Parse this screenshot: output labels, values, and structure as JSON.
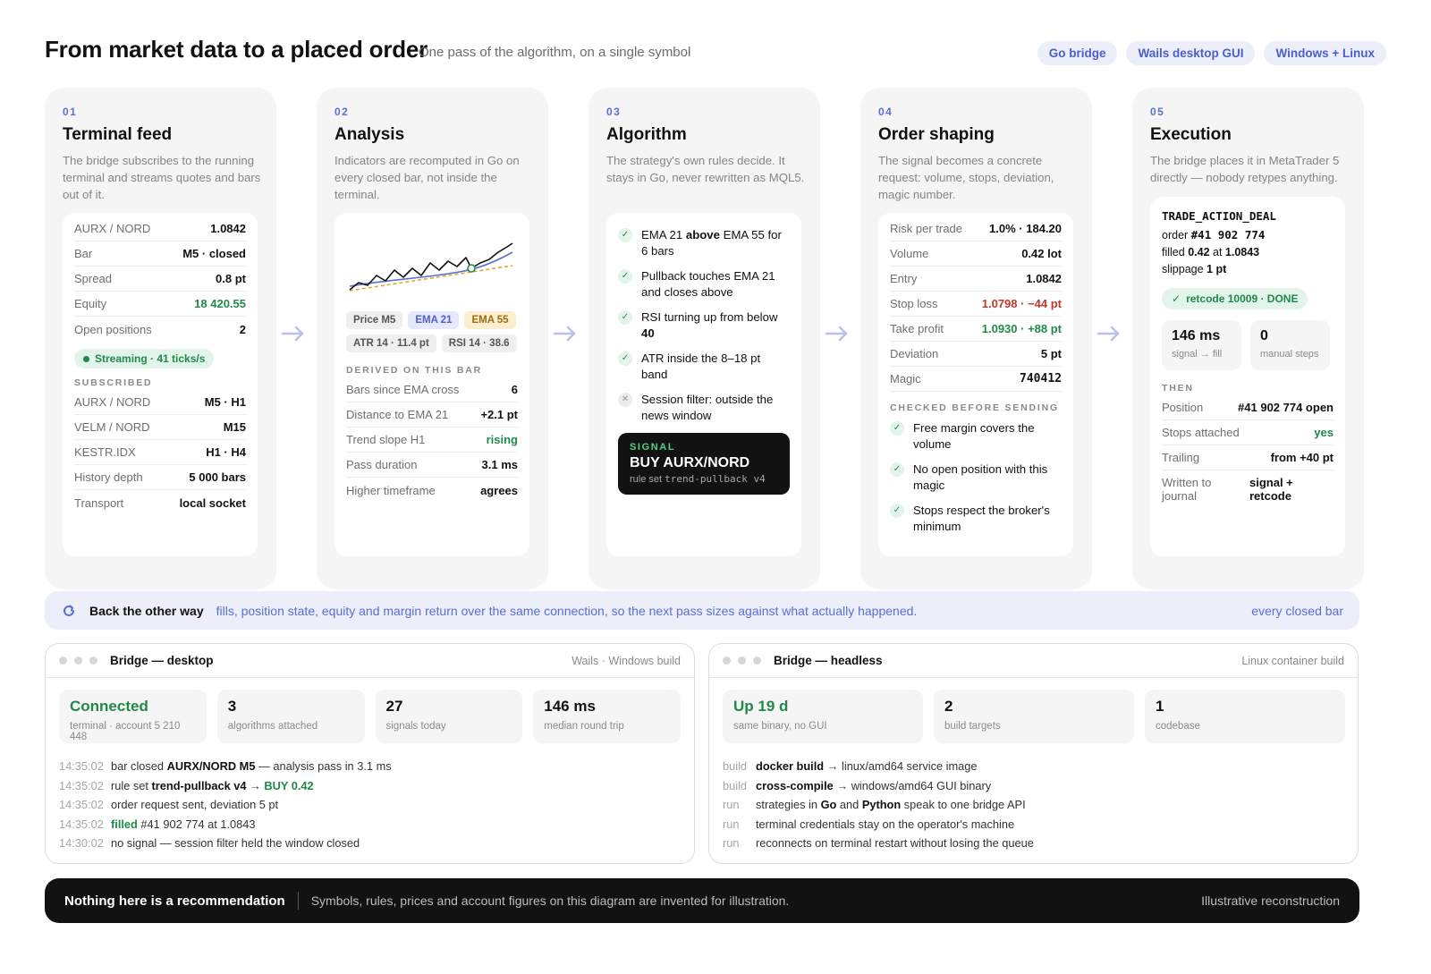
{
  "header": {
    "title": "From market data to a placed order",
    "subtitle": "One pass of the algorithm, on a single symbol",
    "tags": [
      "Go bridge",
      "Wails desktop GUI",
      "Windows + Linux"
    ]
  },
  "colors": {
    "accent": "#5a6fd0",
    "green": "#1f8a48",
    "red": "#c0392b",
    "dark": "#121212"
  },
  "stages": [
    {
      "num": "01",
      "title": "Terminal feed",
      "desc": "The bridge subscribes to the running terminal and streams quotes and bars out of it.",
      "rows": [
        {
          "k": "AURX / NORD",
          "v": "1.0842"
        },
        {
          "k": "Bar",
          "v": "M5 · closed"
        },
        {
          "k": "Spread",
          "v": "0.8 pt"
        },
        {
          "k": "Equity",
          "v": "18 420.55"
        },
        {
          "k": "Open positions",
          "v": "2"
        }
      ],
      "stream": "Streaming · 41 ticks/s",
      "section": "SUBSCRIBED",
      "subs": [
        {
          "k": "AURX / NORD",
          "v": "M5 · H1"
        },
        {
          "k": "VELM / NORD",
          "v": "M15"
        },
        {
          "k": "KESTR.IDX",
          "v": "H1 · H4"
        },
        {
          "k": "History depth",
          "v": "5 000 bars"
        },
        {
          "k": "Transport",
          "v": "local socket"
        }
      ]
    },
    {
      "num": "02",
      "title": "Analysis",
      "desc": "Indicators are recomputed in Go on every closed bar, not inside the terminal.",
      "indicators": [
        "Price M5",
        "EMA 21",
        "EMA 55",
        "ATR 14 · 11.4 pt",
        "RSI 14 · 38.6"
      ],
      "section": "DERIVED ON THIS BAR",
      "rows": [
        {
          "k": "Bars since EMA cross",
          "v": "6"
        },
        {
          "k": "Distance to EMA 21",
          "v": "+2.1 pt"
        },
        {
          "k": "Trend slope H1",
          "v": "rising"
        },
        {
          "k": "Pass duration",
          "v": "3.1 ms"
        },
        {
          "k": "Higher timeframe",
          "v": "agrees"
        }
      ]
    },
    {
      "num": "03",
      "title": "Algorithm",
      "desc": "The strategy's own rules decide. It stays in Go, never rewritten as MQL5.",
      "rules": [
        {
          "a": "EMA 21 ",
          "b": "above",
          "c": " EMA 55 for 6 bars"
        },
        {
          "a": "Pullback touches EMA 21 and closes above",
          "b": "",
          "c": ""
        },
        {
          "a": "RSI turning up from below ",
          "b": "40",
          "c": ""
        },
        {
          "a": "ATR inside the 8–18 pt band",
          "b": "",
          "c": ""
        },
        {
          "a": "Session filter: outside the news window",
          "b": "",
          "c": ""
        }
      ],
      "signal": {
        "label": "SIGNAL",
        "value": "BUY AURX/NORD",
        "ruleset_prefix": "rule set ",
        "ruleset": "trend-pullback v4"
      }
    },
    {
      "num": "04",
      "title": "Order shaping",
      "desc": "The signal becomes a concrete request: volume, stops, deviation, magic number.",
      "rows": [
        {
          "k": "Risk per trade",
          "v": "1.0% · 184.20"
        },
        {
          "k": "Volume",
          "v": "0.42 lot"
        },
        {
          "k": "Entry",
          "v": "1.0842"
        },
        {
          "k": "Stop loss",
          "v": "1.0798 · −44 pt"
        },
        {
          "k": "Take profit",
          "v": "1.0930 · +88 pt"
        },
        {
          "k": "Deviation",
          "v": "5 pt"
        },
        {
          "k": "Magic",
          "v": "740412"
        }
      ],
      "section": "CHECKED BEFORE SENDING",
      "checks": [
        "Free margin covers the volume",
        "No open position with this magic",
        "Stops respect the broker's minimum"
      ]
    },
    {
      "num": "05",
      "title": "Execution",
      "desc": "The bridge places it in MetaTrader 5 directly — nobody retypes anything.",
      "deal": {
        "action": "TRADE_ACTION_DEAL",
        "order_label": "order ",
        "order": "#41 902 774",
        "filled_label": "filled ",
        "filled": "0.42",
        "at_label": " at ",
        "at": "1.0843",
        "slippage_label": "slippage ",
        "slippage": "1 pt"
      },
      "retcode": "retcode 10009 · DONE",
      "minis": [
        {
          "v": "146 ms",
          "l": "signal → fill"
        },
        {
          "v": "0",
          "l": "manual steps"
        }
      ],
      "section": "THEN",
      "rows": [
        {
          "k": "Position",
          "v": "#41 902 774 open"
        },
        {
          "k": "Stops attached",
          "v": "yes"
        },
        {
          "k": "Trailing",
          "v": "from +40 pt"
        },
        {
          "k": "Written to journal",
          "v": "signal + retcode"
        }
      ]
    }
  ],
  "back": {
    "title": "Back the other way",
    "desc": "fills, position state, equity and margin return over the same connection, so the next pass sizes against what actually happened.",
    "right": "every closed bar"
  },
  "desktop": {
    "title": "Bridge — desktop",
    "right": "Wails · Windows build",
    "stats": [
      {
        "v": "Connected",
        "l": "terminal · account 5 210 448"
      },
      {
        "v": "3",
        "l": "algorithms attached"
      },
      {
        "v": "27",
        "l": "signals today"
      },
      {
        "v": "146 ms",
        "l": "median round trip"
      }
    ],
    "log": [
      {
        "ts": "14:35:02",
        "parts": [
          "bar closed ",
          "AURX/NORD M5",
          " — analysis pass in 3.1 ms"
        ]
      },
      {
        "ts": "14:35:02",
        "parts": [
          "rule set ",
          "trend-pullback v4",
          " → ",
          "BUY 0.42"
        ]
      },
      {
        "ts": "14:35:02",
        "parts": [
          "order request sent, deviation 5 pt"
        ]
      },
      {
        "ts": "14:35:02",
        "parts": [
          "filled",
          " #41 902 774 at 1.0843"
        ]
      },
      {
        "ts": "14:30:02",
        "parts": [
          "no signal — session filter held the window closed"
        ]
      }
    ]
  },
  "headless": {
    "title": "Bridge — headless",
    "right": "Linux container build",
    "stats": [
      {
        "v": "Up 19 d",
        "l": "same binary, no GUI"
      },
      {
        "v": "2",
        "l": "build targets"
      },
      {
        "v": "1",
        "l": "codebase"
      }
    ],
    "log": [
      {
        "tp": "build",
        "parts": [
          "docker build",
          " → linux/amd64 service image"
        ]
      },
      {
        "tp": "build",
        "parts": [
          "cross-compile",
          " → windows/amd64 GUI binary"
        ]
      },
      {
        "tp": "run",
        "parts": [
          "strategies in ",
          "Go",
          " and ",
          "Python",
          " speak to one bridge API"
        ]
      },
      {
        "tp": "run",
        "parts": [
          "terminal credentials stay on the operator's machine"
        ]
      },
      {
        "tp": "run",
        "parts": [
          "reconnects on terminal restart without losing the queue"
        ]
      }
    ]
  },
  "footer": {
    "title": "Nothing here is a recommendation",
    "desc": "Symbols, rules, prices and account figures on this diagram are invented for illustration.",
    "right": "Illustrative reconstruction"
  }
}
